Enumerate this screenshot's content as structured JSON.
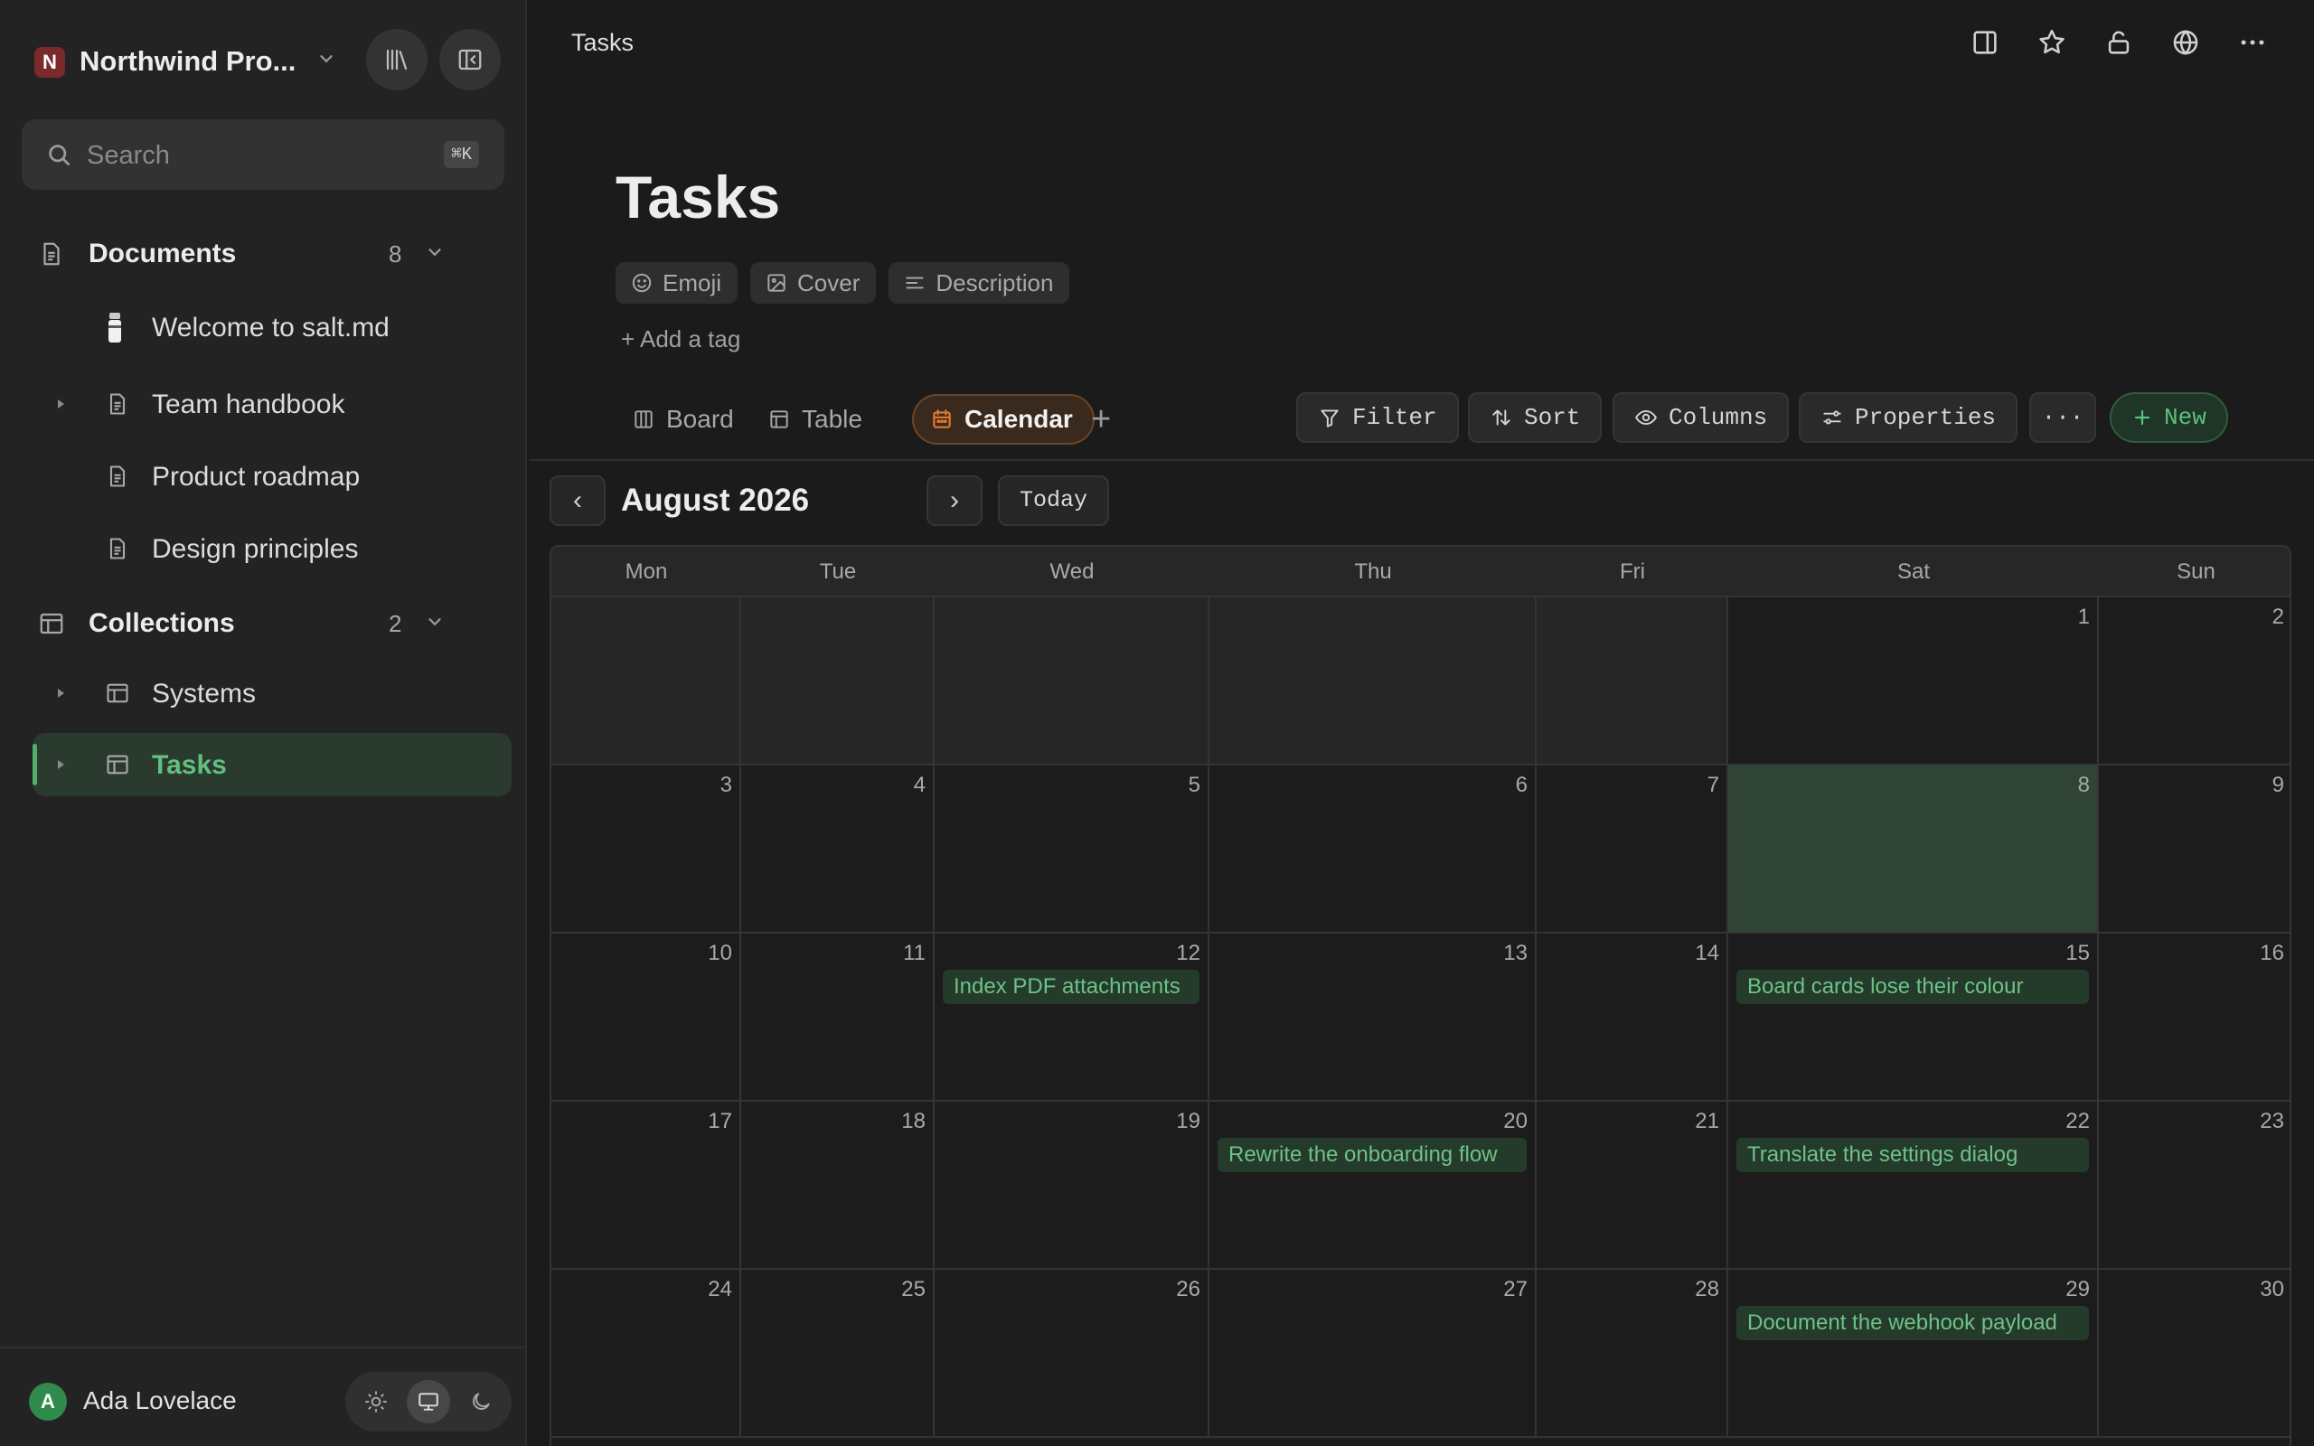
{
  "workspace": {
    "initial": "N",
    "name": "Northwind Pro..."
  },
  "search": {
    "placeholder": "Search",
    "shortcut": "⌘K"
  },
  "sidebar": {
    "documents": {
      "label": "Documents",
      "count": "8",
      "items": [
        {
          "label": "Welcome to salt.md"
        },
        {
          "label": "Team handbook"
        },
        {
          "label": "Product roadmap"
        },
        {
          "label": "Design principles"
        }
      ]
    },
    "collections": {
      "label": "Collections",
      "count": "2",
      "items": [
        {
          "label": "Systems"
        },
        {
          "label": "Tasks"
        }
      ]
    }
  },
  "user": {
    "initial": "A",
    "name": "Ada Lovelace"
  },
  "header": {
    "breadcrumb": "Tasks"
  },
  "page": {
    "title": "Tasks",
    "meta": {
      "emoji": "Emoji",
      "cover": "Cover",
      "description": "Description"
    },
    "add_tag": "+ Add a tag"
  },
  "views": {
    "board": "Board",
    "table": "Table",
    "calendar": "Calendar",
    "add": "+"
  },
  "toolbar": {
    "filter": "Filter",
    "sort": "Sort",
    "columns": "Columns",
    "properties": "Properties",
    "more": "···",
    "new": "New"
  },
  "calendar": {
    "prev": "‹",
    "next": "›",
    "month": "August 2026",
    "today_label": "Today",
    "weekdays": [
      "Mon",
      "Tue",
      "Wed",
      "Thu",
      "Fri",
      "Sat",
      "Sun"
    ],
    "highlighted_day": "8",
    "weeks": [
      [
        "",
        "",
        "",
        "",
        "",
        "1",
        "2"
      ],
      [
        "3",
        "4",
        "5",
        "6",
        "7",
        "8",
        "9"
      ],
      [
        "10",
        "11",
        "12",
        "13",
        "14",
        "15",
        "16"
      ],
      [
        "17",
        "18",
        "19",
        "20",
        "21",
        "22",
        "23"
      ],
      [
        "24",
        "25",
        "26",
        "27",
        "28",
        "29",
        "30"
      ]
    ],
    "events": {
      "12": "Index PDF attachments",
      "15": "Board cards lose their colour",
      "20": "Rewrite the onboarding flow",
      "22": "Translate the settings dialog",
      "29": "Document the webhook payload"
    }
  },
  "colors": {
    "accent_green": "#62c07f",
    "accent_orange": "#e07a2e",
    "workspace_red": "#7a2a2a"
  }
}
